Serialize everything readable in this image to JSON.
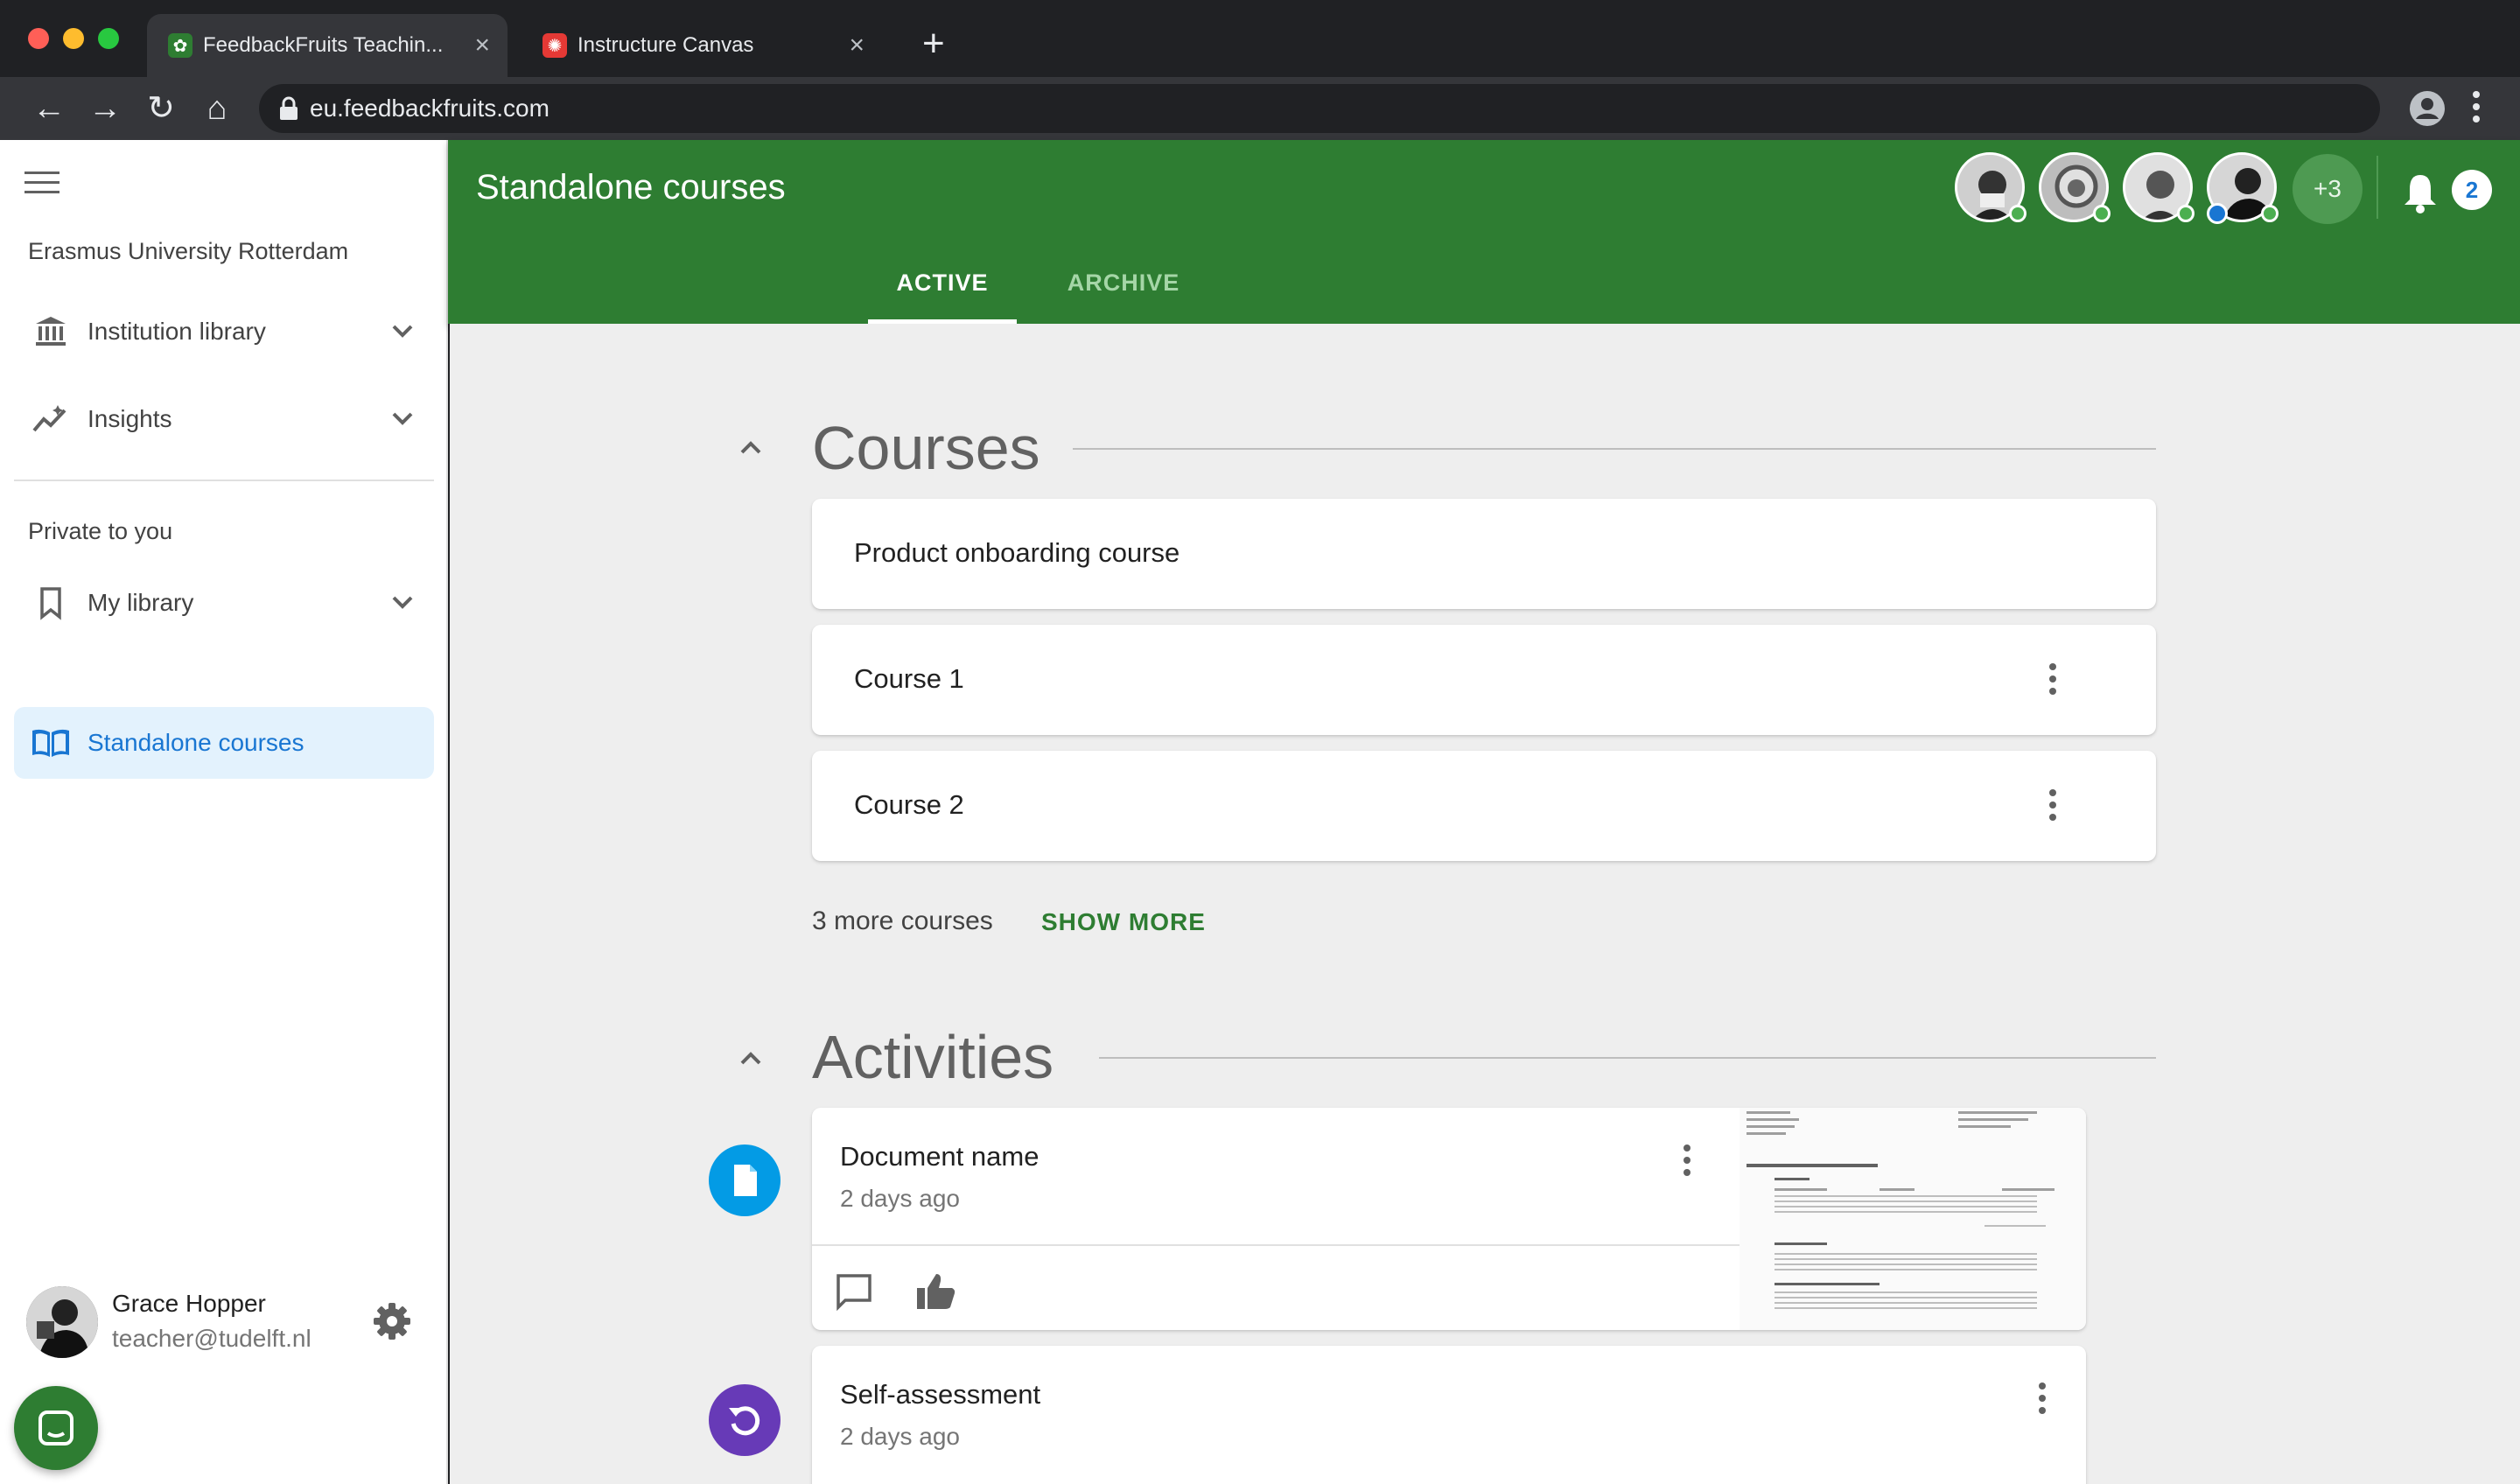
{
  "browser": {
    "tabs": [
      {
        "title": "FeedbackFruits Teachin...",
        "active": true
      },
      {
        "title": "Instructure Canvas",
        "active": false
      }
    ],
    "new_tab_label": "+",
    "close_label": "×",
    "url": "eu.feedbackfruits.com"
  },
  "sidebar": {
    "institution": "Erasmus University Rotterdam",
    "items": [
      {
        "label": "Institution library"
      },
      {
        "label": "Insights"
      }
    ],
    "private_heading": "Private to you",
    "private_items": [
      {
        "label": "My library"
      },
      {
        "label": "Standalone courses"
      }
    ],
    "user": {
      "name": "Grace Hopper",
      "email": "teacher@tudelft.nl"
    }
  },
  "header": {
    "title": "Standalone courses",
    "tabs": [
      {
        "label": "ACTIVE",
        "active": true
      },
      {
        "label": "ARCHIVE",
        "active": false
      }
    ],
    "more_avatars": "+3",
    "notification_count": "2"
  },
  "courses": {
    "title": "Courses",
    "items": [
      {
        "title": "Product onboarding course"
      },
      {
        "title": "Course 1"
      },
      {
        "title": "Course 2"
      }
    ],
    "more_text": "3 more courses",
    "show_more": "SHOW MORE"
  },
  "activities": {
    "title": "Activities",
    "items": [
      {
        "title": "Document name",
        "subtitle": "2 days ago"
      },
      {
        "title": "Self-assessment",
        "subtitle": "2 days ago"
      }
    ]
  },
  "colors": {
    "brand_green": "#2e7d32",
    "active_blue": "#1976d2",
    "doc_blue": "#039be5",
    "self_purple": "#673ab7"
  }
}
